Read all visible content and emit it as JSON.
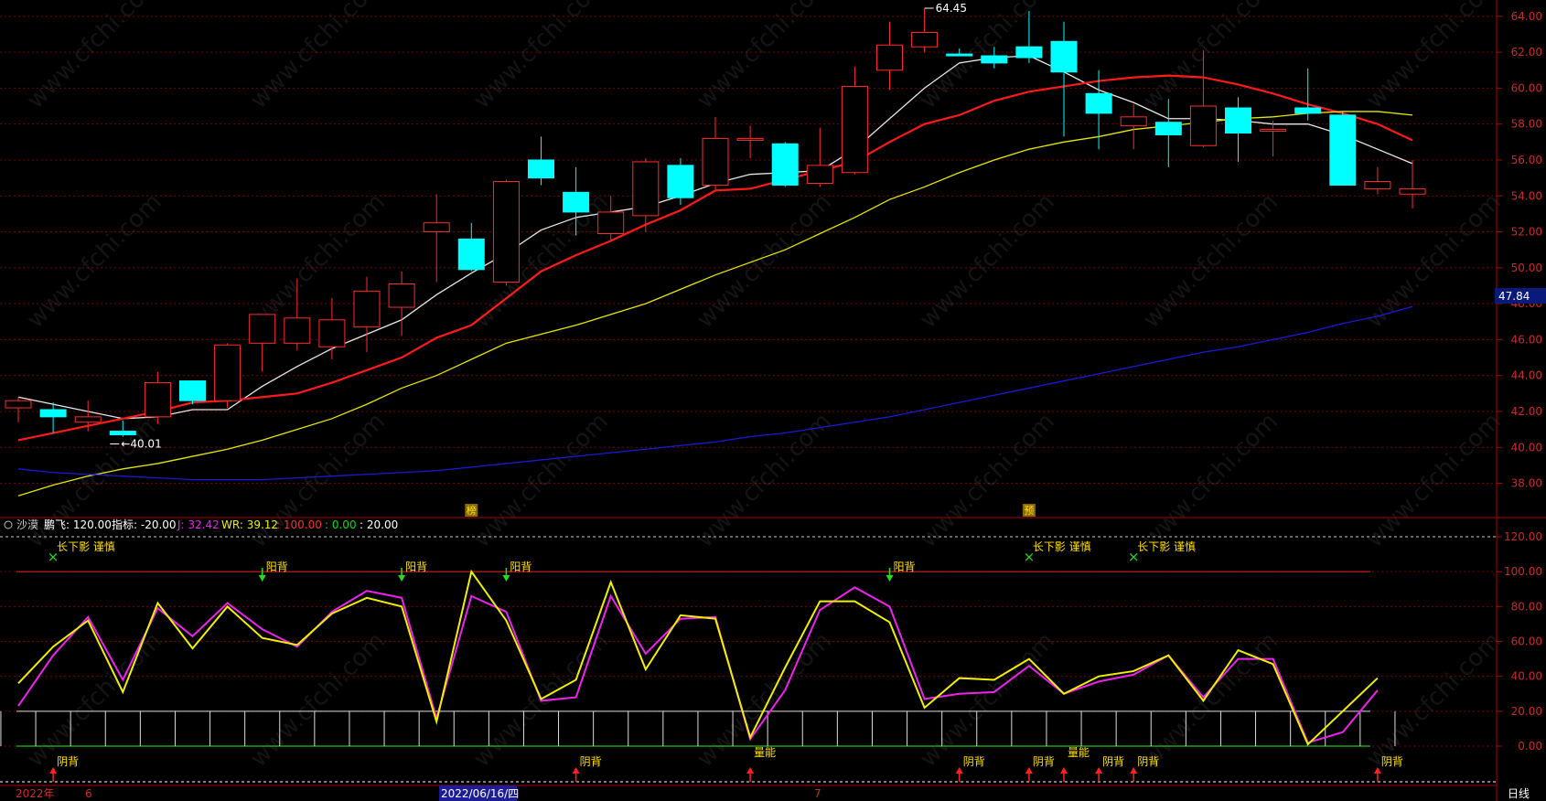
{
  "chart_data": [
    {
      "type": "candlestick",
      "panel": "price",
      "ylim": [
        36.5,
        64.5
      ],
      "yticks": [
        "64.00",
        "62.00",
        "60.00",
        "58.00",
        "56.00",
        "54.00",
        "52.00",
        "50.00",
        "48.00",
        "46.00",
        "44.00",
        "42.00",
        "40.00",
        "38.00"
      ],
      "current_price_label": "47.84",
      "high_label": "64.45",
      "low_label": "40.01",
      "ohlc": [
        {
          "o": 42.2,
          "h": 42.8,
          "l": 41.4,
          "c": 42.6
        },
        {
          "o": 42.1,
          "h": 42.5,
          "l": 40.8,
          "c": 41.7
        },
        {
          "o": 41.4,
          "h": 42.6,
          "l": 40.9,
          "c": 41.7
        },
        {
          "o": 40.9,
          "h": 41.5,
          "l": 40.6,
          "c": 40.7
        },
        {
          "o": 41.7,
          "h": 44.2,
          "l": 41.3,
          "c": 43.6
        },
        {
          "o": 43.7,
          "h": 43.7,
          "l": 42.4,
          "c": 42.6
        },
        {
          "o": 42.6,
          "h": 45.8,
          "l": 42.2,
          "c": 45.7
        },
        {
          "o": 45.8,
          "h": 47.1,
          "l": 44.2,
          "c": 47.4
        },
        {
          "o": 45.8,
          "h": 49.4,
          "l": 45.4,
          "c": 47.2
        },
        {
          "o": 45.6,
          "h": 48.3,
          "l": 44.9,
          "c": 47.1
        },
        {
          "o": 46.7,
          "h": 49.5,
          "l": 45.3,
          "c": 48.7
        },
        {
          "o": 47.8,
          "h": 49.8,
          "l": 46.2,
          "c": 49.1
        },
        {
          "o": 52.0,
          "h": 54.1,
          "l": 49.2,
          "c": 52.5
        },
        {
          "o": 51.6,
          "h": 52.5,
          "l": 49.8,
          "c": 49.9
        },
        {
          "o": 49.2,
          "h": 54.9,
          "l": 49.0,
          "c": 54.8
        },
        {
          "o": 56.0,
          "h": 57.3,
          "l": 54.6,
          "c": 55.0
        },
        {
          "o": 54.2,
          "h": 55.6,
          "l": 51.8,
          "c": 53.1
        },
        {
          "o": 51.9,
          "h": 54.0,
          "l": 51.5,
          "c": 53.1
        },
        {
          "o": 52.9,
          "h": 56.1,
          "l": 52.0,
          "c": 55.9
        },
        {
          "o": 55.7,
          "h": 56.1,
          "l": 53.5,
          "c": 53.9
        },
        {
          "o": 54.6,
          "h": 58.4,
          "l": 54.3,
          "c": 57.2
        },
        {
          "o": 57.2,
          "h": 57.9,
          "l": 56.1,
          "c": 57.2
        },
        {
          "o": 56.9,
          "h": 57.0,
          "l": 54.5,
          "c": 54.6
        },
        {
          "o": 54.7,
          "h": 57.8,
          "l": 54.5,
          "c": 55.7
        },
        {
          "o": 55.3,
          "h": 61.2,
          "l": 55.2,
          "c": 60.1
        },
        {
          "o": 61.0,
          "h": 63.7,
          "l": 59.9,
          "c": 62.4
        },
        {
          "o": 62.3,
          "h": 64.45,
          "l": 62.0,
          "c": 63.1
        },
        {
          "o": 61.9,
          "h": 62.2,
          "l": 61.8,
          "c": 61.8
        },
        {
          "o": 61.8,
          "h": 62.3,
          "l": 61.1,
          "c": 61.4
        },
        {
          "o": 62.3,
          "h": 64.3,
          "l": 61.4,
          "c": 61.7
        },
        {
          "o": 62.6,
          "h": 63.7,
          "l": 57.3,
          "c": 60.9
        },
        {
          "o": 59.7,
          "h": 61.0,
          "l": 56.6,
          "c": 58.6
        },
        {
          "o": 57.9,
          "h": 59.1,
          "l": 56.6,
          "c": 58.4
        },
        {
          "o": 58.1,
          "h": 59.4,
          "l": 55.6,
          "c": 57.4
        },
        {
          "o": 56.8,
          "h": 62.1,
          "l": 56.7,
          "c": 59.0
        },
        {
          "o": 58.9,
          "h": 59.5,
          "l": 55.9,
          "c": 57.5
        },
        {
          "o": 57.6,
          "h": 58.2,
          "l": 56.2,
          "c": 57.7
        },
        {
          "o": 58.9,
          "h": 61.1,
          "l": 58.2,
          "c": 58.6
        },
        {
          "o": 58.5,
          "h": 58.7,
          "l": 54.6,
          "c": 54.6
        },
        {
          "o": 54.4,
          "h": 55.6,
          "l": 54.1,
          "c": 54.8
        },
        {
          "o": 54.1,
          "h": 56.0,
          "l": 53.3,
          "c": 54.4
        }
      ],
      "ma": [
        {
          "name": "MA5",
          "color": "#e8e8e8",
          "values": [
            42.8,
            42.4,
            42.0,
            41.6,
            41.7,
            42.1,
            42.1,
            43.4,
            44.5,
            45.5,
            46.3,
            47.1,
            48.5,
            49.7,
            50.8,
            52.1,
            52.8,
            53.1,
            53.4,
            54.0,
            54.7,
            55.2,
            55.3,
            55.4,
            56.6,
            58.3,
            60.0,
            61.4,
            61.7,
            61.8,
            60.9,
            59.9,
            59.2,
            58.3,
            58.3,
            58.2,
            58.0,
            58.0,
            57.4,
            56.6,
            55.8
          ]
        },
        {
          "name": "MA10",
          "color": "#ff1a1a",
          "values": [
            40.4,
            40.8,
            41.2,
            41.6,
            42.0,
            42.5,
            42.6,
            42.8,
            43.0,
            43.6,
            44.3,
            45.0,
            46.1,
            46.8,
            48.3,
            49.8,
            50.7,
            51.5,
            52.4,
            53.2,
            54.3,
            54.4,
            54.9,
            55.4,
            55.9,
            57.0,
            58.0,
            58.5,
            59.3,
            59.8,
            60.1,
            60.4,
            60.6,
            60.7,
            60.6,
            60.2,
            59.7,
            59.1,
            58.6,
            58.0,
            57.1
          ]
        },
        {
          "name": "MA20",
          "color": "#e6e600",
          "values": [
            37.3,
            37.9,
            38.4,
            38.8,
            39.1,
            39.5,
            39.9,
            40.4,
            41.0,
            41.6,
            42.4,
            43.3,
            44.0,
            44.9,
            45.8,
            46.3,
            46.8,
            47.4,
            48.0,
            48.8,
            49.6,
            50.3,
            51.0,
            51.9,
            52.8,
            53.8,
            54.5,
            55.3,
            56.0,
            56.6,
            57.0,
            57.3,
            57.7,
            57.9,
            58.1,
            58.3,
            58.4,
            58.6,
            58.7,
            58.7,
            58.5
          ]
        },
        {
          "name": "MA60",
          "color": "#1a1ad6",
          "values": [
            38.8,
            38.6,
            38.5,
            38.4,
            38.3,
            38.2,
            38.2,
            38.2,
            38.3,
            38.4,
            38.5,
            38.6,
            38.7,
            38.9,
            39.1,
            39.3,
            39.5,
            39.7,
            39.9,
            40.1,
            40.3,
            40.6,
            40.8,
            41.1,
            41.4,
            41.7,
            42.1,
            42.5,
            42.9,
            43.3,
            43.7,
            44.1,
            44.5,
            44.9,
            45.3,
            45.6,
            46.0,
            46.4,
            46.9,
            47.3,
            47.84
          ]
        }
      ],
      "marker_labels": [
        {
          "index": 13,
          "text": "榜"
        },
        {
          "index": 29,
          "text": "预"
        }
      ]
    },
    {
      "type": "line",
      "panel": "indicator",
      "ylim": [
        0,
        120
      ],
      "yticks": [
        "120.00",
        "100.00",
        "80.00",
        "60.00",
        "40.00",
        "20.00",
        "0.00"
      ],
      "header": {
        "name": "沙漠",
        "p1": "鹏飞: 120.00",
        "p2": "指标: -20.00",
        "j": "J: 32.42",
        "wr": "WR: 39.12",
        "v100": ": 100.00",
        "v0": ": 0.00",
        "v20": ": 20.00"
      },
      "series": [
        {
          "name": "J",
          "color": "#ee22ee",
          "values": [
            23,
            52,
            74,
            38,
            79,
            63,
            82,
            67,
            57,
            77,
            89,
            85,
            16,
            86,
            77,
            26,
            28,
            86,
            53,
            73,
            74,
            4,
            32,
            78,
            91,
            80,
            27,
            30,
            31,
            46,
            30,
            37,
            41,
            52,
            28,
            50,
            50,
            2,
            8,
            32
          ]
        },
        {
          "name": "WR",
          "color": "#f0f000",
          "values": [
            36,
            57,
            72,
            31,
            82,
            56,
            80,
            62,
            58,
            76,
            85,
            80,
            14,
            100,
            72,
            27,
            38,
            94,
            44,
            75,
            73,
            5,
            45,
            83,
            83,
            71,
            22,
            39,
            38,
            50,
            30,
            40,
            43,
            52,
            26,
            55,
            47,
            1,
            20,
            39
          ]
        }
      ],
      "top_markers": [
        {
          "index": 1,
          "type": "x",
          "text": "长下影 谨慎"
        },
        {
          "index": 7,
          "type": "down",
          "text": "阳背"
        },
        {
          "index": 11,
          "type": "down",
          "text": "阳背"
        },
        {
          "index": 14,
          "type": "down",
          "text": "阳背"
        },
        {
          "index": 25,
          "type": "down",
          "text": "阳背"
        },
        {
          "index": 29,
          "type": "x",
          "text": "长下影 谨慎"
        },
        {
          "index": 32,
          "type": "x",
          "text": "长下影 谨慎"
        }
      ],
      "bottom_markers": [
        {
          "index": 1,
          "text": "阴背"
        },
        {
          "index": 16,
          "text": "阴背"
        },
        {
          "index": 21,
          "text": "量能"
        },
        {
          "index": 27,
          "text": "阴背"
        },
        {
          "index": 29,
          "text": "阴背"
        },
        {
          "index": 30,
          "text": "量能"
        },
        {
          "index": 31,
          "text": "阴背"
        },
        {
          "index": 32,
          "text": "阴背"
        },
        {
          "index": 39,
          "text": "阴背"
        }
      ]
    }
  ],
  "date_axis": {
    "year": "2022年",
    "m6": "6",
    "cursor_date": "2022/06/16/四",
    "m7": "7",
    "period": "日线"
  },
  "watermark": "www.cfchi.com",
  "colors": {
    "up": "#ff2a2a",
    "down": "#00ffff",
    "grid": "#7a0000",
    "axis": "#b00000",
    "tick": "#cc2a2a",
    "priceTag": "#0a1a7a"
  }
}
